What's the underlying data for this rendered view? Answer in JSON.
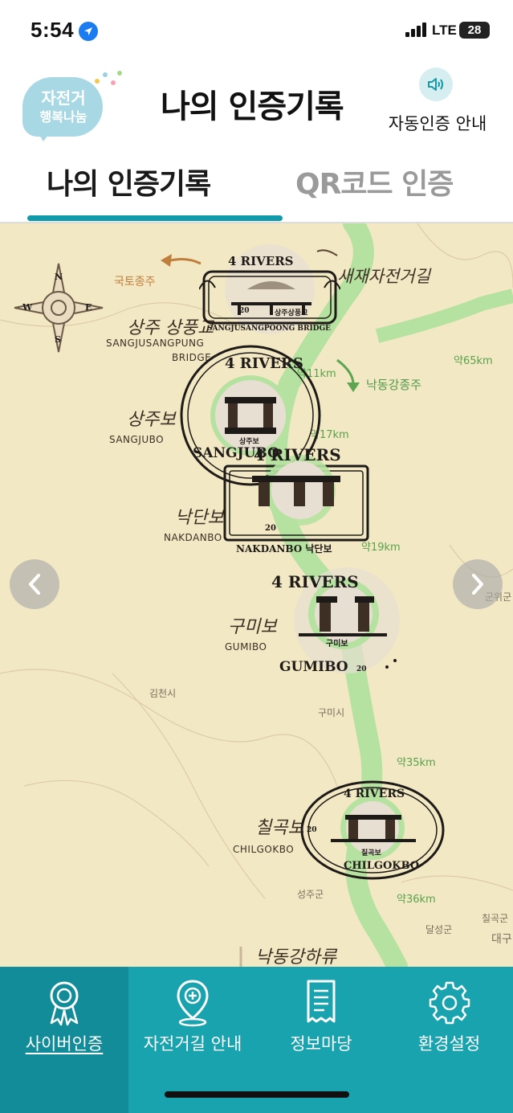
{
  "status_bar": {
    "time": "5:54",
    "network": "LTE",
    "battery": "28"
  },
  "header": {
    "logo_line1": "자전거",
    "logo_line2": "행복나눔",
    "title": "나의 인증기록",
    "guide_label": "자동인증 안내",
    "guide_icon": "speaker-icon"
  },
  "tabs": [
    {
      "label": "나의 인증기록",
      "active": true
    },
    {
      "label": "QR코드 인증",
      "active": false
    }
  ],
  "map": {
    "compass": {
      "n": "N",
      "e": "E",
      "s": "S",
      "w": "W"
    },
    "route_labels": {
      "gukto": "국토종주",
      "saejae": "새재자전거길",
      "nakdong_jongju": "낙동강종주",
      "nakdong_haryu": "낙동강하류"
    },
    "places": [
      {
        "ko": "상주 상풍교",
        "en1": "SANGJUSANGPUNG",
        "en2": "BRIDGE"
      },
      {
        "ko": "상주보",
        "en1": "SANGJUBO"
      },
      {
        "ko": "낙단보",
        "en1": "NAKDANBO"
      },
      {
        "ko": "구미보",
        "en1": "GUMIBO"
      },
      {
        "ko": "칠곡보",
        "en1": "CHILGOKBO"
      }
    ],
    "distances": [
      "약65km",
      "약11km",
      "약17km",
      "약19km",
      "약35km",
      "약36km"
    ],
    "cities": [
      "김천시",
      "구미시",
      "성주군",
      "달성군",
      "칠곡군",
      "군위군",
      "대구"
    ],
    "stamps": [
      {
        "top": "4 RIVERS",
        "bottom": "SANGJUSANGPOONG BRIDGE",
        "num": "20",
        "ko": "상주상풍교"
      },
      {
        "top": "4 RIVERS",
        "bottom": "SANGJUBO",
        "num": "20",
        "ko": "상주보"
      },
      {
        "top": "4 RIVERS",
        "bottom": "NAKDANBO 낙단보",
        "num": "20"
      },
      {
        "top": "4 RIVERS",
        "bottom": "GUMIBO",
        "num": "20",
        "ko": "구미보"
      },
      {
        "top": "4 RIVERS",
        "bottom": "CHILGOKBO",
        "num": "20",
        "ko": "칠곡보"
      }
    ],
    "prev_icon": "chevron-left-icon",
    "next_icon": "chevron-right-icon"
  },
  "bottom_nav": [
    {
      "label": "사이버인증",
      "icon": "award-ribbon-icon",
      "active": true
    },
    {
      "label": "자전거길 안내",
      "icon": "map-pin-icon",
      "active": false
    },
    {
      "label": "정보마당",
      "icon": "document-icon",
      "active": false
    },
    {
      "label": "환경설정",
      "icon": "gear-icon",
      "active": false
    }
  ],
  "colors": {
    "accent": "#119aaa",
    "nav_bg": "#18a3ae",
    "nav_active": "#128c98",
    "map_bg": "#f3e8c4",
    "route_green": "#8fcf7d"
  }
}
